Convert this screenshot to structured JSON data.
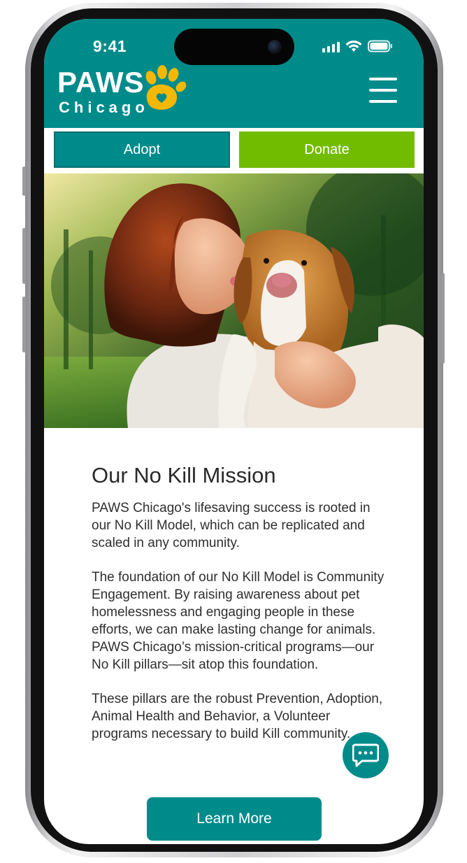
{
  "status_bar": {
    "time": "9:41",
    "icons": [
      "cellular-signal-icon",
      "wifi-icon",
      "battery-icon"
    ]
  },
  "header": {
    "logo_primary": "PAWS",
    "logo_secondary": "Chicago",
    "menu_icon": "hamburger-menu-icon"
  },
  "actions": {
    "adopt_label": "Adopt",
    "donate_label": "Donate"
  },
  "hero": {
    "image_description": "woman-kissing-beagle-photo"
  },
  "mission": {
    "title": "Our No Kill Mission",
    "paragraphs": [
      "PAWS Chicago's lifesaving success is rooted in our No Kill Model, which can be replicated and scaled in any community.",
      "The foundation of our No Kill Model is Community Engagement. By raising awareness about pet homelessness and engaging people in these efforts, we can make lasting change for animals. PAWS Chicago’s mission-critical programs—our No Kill pillars—sit atop this foundation.",
      "These pillars are the robust Prevention, Adoption, Animal Health and Behavior, a Volunteer programs necessary to build Kill community."
    ],
    "cta_label": "Learn More"
  },
  "chat": {
    "icon": "chat-bubble-icon"
  },
  "colors": {
    "teal": "#008b8b",
    "green": "#72bc00",
    "paw_yellow": "#f5b800",
    "text": "#2f2f2f"
  }
}
